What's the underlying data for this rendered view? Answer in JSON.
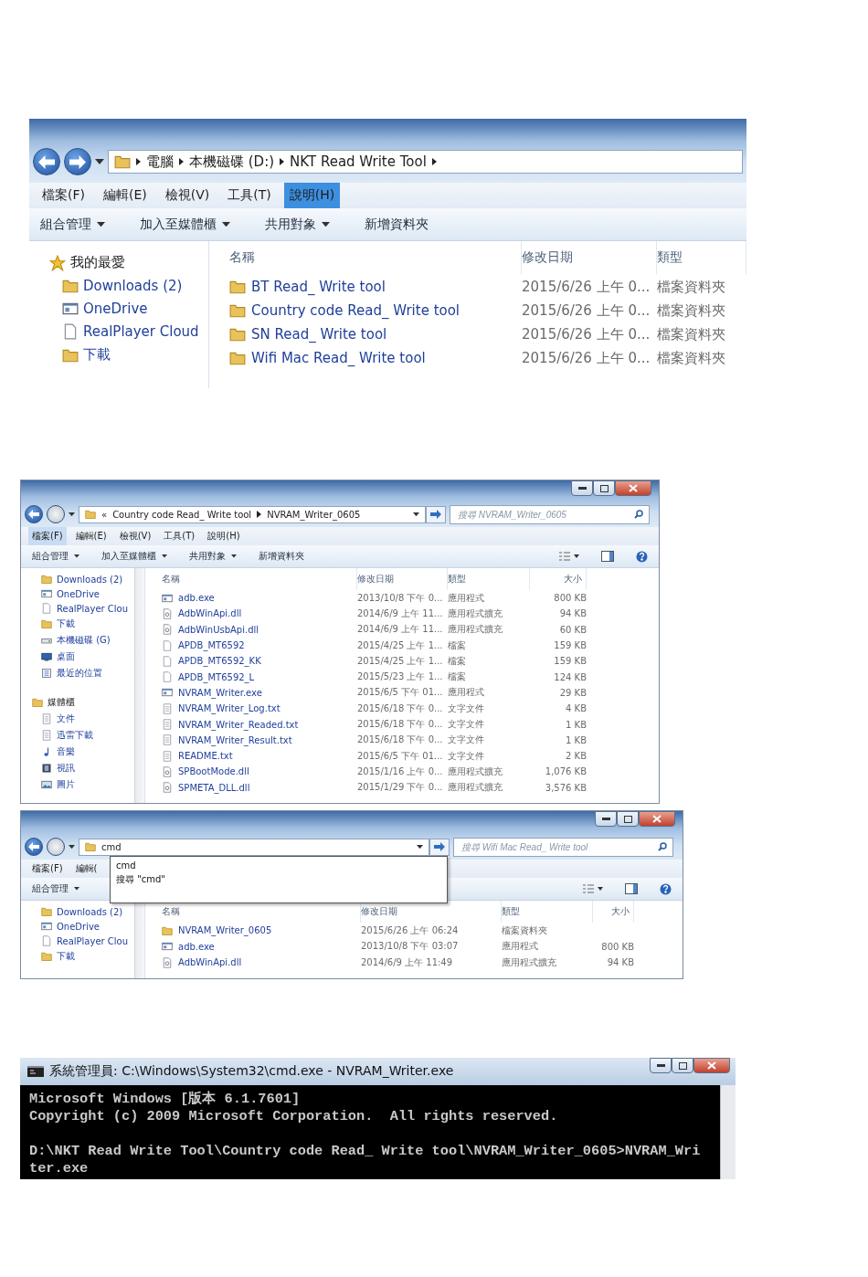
{
  "explorer_1": {
    "forward_disabled": false,
    "address": {
      "segments": [
        "電腦",
        "本機磁碟 (D:)",
        "NKT Read Write Tool"
      ]
    },
    "menu": [
      {
        "label": "檔案(F)",
        "selected": false
      },
      {
        "label": "編輯(E)",
        "selected": false
      },
      {
        "label": "檢視(V)",
        "selected": false
      },
      {
        "label": "工具(T)",
        "selected": false
      },
      {
        "label": "說明(H)",
        "selected": true
      }
    ],
    "toolbar": [
      {
        "label": "組合管理",
        "dropdown": true
      },
      {
        "label": "加入至媒體櫃",
        "dropdown": true
      },
      {
        "label": "共用對象",
        "dropdown": true
      },
      {
        "label": "新增資料夾",
        "dropdown": false
      }
    ],
    "sidebar": [
      {
        "label": "我的最愛",
        "kind": "star"
      },
      {
        "label": "Downloads (2)",
        "kind": "downloads"
      },
      {
        "label": "OneDrive",
        "kind": "onedrive"
      },
      {
        "label": "RealPlayer Cloud",
        "kind": "page"
      },
      {
        "label": "下載",
        "kind": "downloads"
      }
    ],
    "columns": [
      "名稱",
      "修改日期",
      "類型"
    ],
    "rows": [
      {
        "name": "BT Read_ Write tool",
        "kind": "folder",
        "date": "2015/6/26 上午 0...",
        "type": "檔案資料夾"
      },
      {
        "name": "Country code Read_ Write tool",
        "kind": "folder",
        "date": "2015/6/26 上午 0...",
        "type": "檔案資料夾"
      },
      {
        "name": "SN Read_ Write tool",
        "kind": "folder",
        "date": "2015/6/26 上午 0...",
        "type": "檔案資料夾"
      },
      {
        "name": "Wifi Mac Read_ Write tool",
        "kind": "folder",
        "date": "2015/6/26 上午 0...",
        "type": "檔案資料夾"
      }
    ]
  },
  "explorer_2": {
    "window_controls": true,
    "forward_disabled": true,
    "address": {
      "overflow_mark": "«",
      "segments": [
        "Country code Read_ Write tool",
        "NVRAM_Writer_0605"
      ]
    },
    "search": {
      "placeholder": "搜尋 NVRAM_Writer_0605"
    },
    "menu": [
      {
        "label": "檔案(F)",
        "selected": true
      },
      {
        "label": "編輯(E)",
        "selected": false
      },
      {
        "label": "檢視(V)",
        "selected": false
      },
      {
        "label": "工具(T)",
        "selected": false
      },
      {
        "label": "說明(H)",
        "selected": false
      }
    ],
    "toolbar": [
      {
        "label": "組合管理",
        "dropdown": true
      },
      {
        "label": "加入至媒體櫃",
        "dropdown": true
      },
      {
        "label": "共用對象",
        "dropdown": true
      },
      {
        "label": "新增資料夾",
        "dropdown": false
      }
    ],
    "sidebar": [
      {
        "label": "Downloads (2)",
        "kind": "downloads"
      },
      {
        "label": "OneDrive",
        "kind": "onedrive"
      },
      {
        "label": "RealPlayer Clou",
        "kind": "page"
      },
      {
        "label": "下載",
        "kind": "downloads"
      },
      {
        "label": "本機磁碟 (G)",
        "kind": "drive"
      },
      {
        "label": "桌面",
        "kind": "desktop"
      },
      {
        "label": "最近的位置",
        "kind": "recent"
      },
      {
        "label": "媒體櫃",
        "kind": "library",
        "children": [
          {
            "label": "文件",
            "kind": "docs"
          },
          {
            "label": "迅雷下載",
            "kind": "docs"
          },
          {
            "label": "音樂",
            "kind": "music"
          },
          {
            "label": "視訊",
            "kind": "video"
          },
          {
            "label": "圖片",
            "kind": "pictures"
          }
        ]
      }
    ],
    "columns": [
      "名稱",
      "修改日期",
      "類型",
      "大小"
    ],
    "rows": [
      {
        "name": "adb.exe",
        "kind": "exe",
        "date": "2013/10/8 下午 0...",
        "type": "應用程式",
        "size": "800 KB"
      },
      {
        "name": "AdbWinApi.dll",
        "kind": "dll",
        "date": "2014/6/9 上午 11...",
        "type": "應用程式擴充",
        "size": "94 KB"
      },
      {
        "name": "AdbWinUsbApi.dll",
        "kind": "dll",
        "date": "2014/6/9 上午 11...",
        "type": "應用程式擴充",
        "size": "60 KB"
      },
      {
        "name": "APDB_MT6592",
        "kind": "file",
        "date": "2015/4/25 上午 1...",
        "type": "檔案",
        "size": "159 KB"
      },
      {
        "name": "APDB_MT6592_KK",
        "kind": "file",
        "date": "2015/4/25 上午 1...",
        "type": "檔案",
        "size": "159 KB"
      },
      {
        "name": "APDB_MT6592_L",
        "kind": "file",
        "date": "2015/5/23 上午 1...",
        "type": "檔案",
        "size": "124 KB"
      },
      {
        "name": "NVRAM_Writer.exe",
        "kind": "exe",
        "date": "2015/6/5 下午 01...",
        "type": "應用程式",
        "size": "29 KB"
      },
      {
        "name": "NVRAM_Writer_Log.txt",
        "kind": "txt",
        "date": "2015/6/18 下午 0...",
        "type": "文字文件",
        "size": "4 KB"
      },
      {
        "name": "NVRAM_Writer_Readed.txt",
        "kind": "txt",
        "date": "2015/6/18 下午 0...",
        "type": "文字文件",
        "size": "1 KB"
      },
      {
        "name": "NVRAM_Writer_Result.txt",
        "kind": "txt",
        "date": "2015/6/18 下午 0...",
        "type": "文字文件",
        "size": "1 KB"
      },
      {
        "name": "README.txt",
        "kind": "txt",
        "date": "2015/6/5 下午 01...",
        "type": "文字文件",
        "size": "2 KB"
      },
      {
        "name": "SPBootMode.dll",
        "kind": "dll",
        "date": "2015/1/16 上午 0...",
        "type": "應用程式擴充",
        "size": "1,076 KB"
      },
      {
        "name": "SPMETA_DLL.dll",
        "kind": "dll",
        "date": "2015/1/29 下午 0...",
        "type": "應用程式擴充",
        "size": "3,576 KB"
      }
    ]
  },
  "explorer_3": {
    "window_controls": true,
    "forward_disabled": true,
    "address": {
      "value": "cmd",
      "suggestions": [
        "cmd",
        "搜尋 \"cmd\""
      ]
    },
    "search": {
      "placeholder": "搜尋 Wifi Mac Read_ Write tool"
    },
    "menu": [
      {
        "label": "檔案(F)",
        "selected": false
      },
      {
        "label": "編輯(",
        "selected": false
      }
    ],
    "toolbar": [
      {
        "label": "組合管理",
        "dropdown": true
      }
    ],
    "sidebar": [
      {
        "label": "Downloads (2)",
        "kind": "downloads"
      },
      {
        "label": "OneDrive",
        "kind": "onedrive"
      },
      {
        "label": "RealPlayer Clou",
        "kind": "page"
      },
      {
        "label": "下載",
        "kind": "downloads"
      }
    ],
    "columns": [
      "名稱",
      "修改日期",
      "類型",
      "大小"
    ],
    "rows": [
      {
        "name": "NVRAM_Writer_0605",
        "kind": "folder",
        "date": "2015/6/26 上午 06:24",
        "type": "檔案資料夾"
      },
      {
        "name": "adb.exe",
        "kind": "exe",
        "date": "2013/10/8 下午 03:07",
        "type": "應用程式",
        "size": "800 KB"
      },
      {
        "name": "AdbWinApi.dll",
        "kind": "dll",
        "date": "2014/6/9 上午 11:49",
        "type": "應用程式擴充",
        "size": "94 KB"
      }
    ]
  },
  "console": {
    "title": "系統管理員: C:\\Windows\\System32\\cmd.exe - NVRAM_Writer.exe",
    "banner": [
      "Microsoft Windows [版本 6.1.7601]",
      "Copyright (c) 2009 Microsoft Corporation.  All rights reserved."
    ],
    "command": [
      "D:\\NKT Read Write Tool\\Country code Read_ Write tool\\NVRAM_Writer_0605>NVRAM_Wri",
      "ter.exe"
    ]
  }
}
